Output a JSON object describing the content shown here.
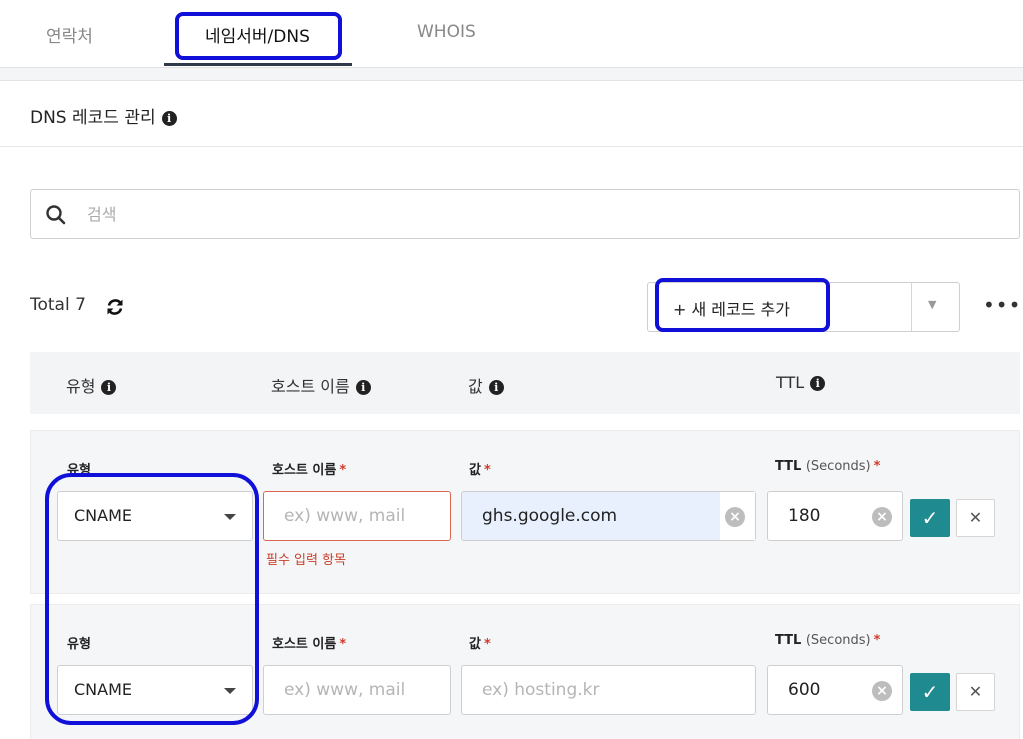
{
  "tabs": [
    {
      "label": "연락처"
    },
    {
      "label": "네임서버/DNS",
      "active": true
    },
    {
      "label": "WHOIS"
    }
  ],
  "panel": {
    "title": "DNS 레코드 관리",
    "search_placeholder": "검색",
    "total_label": "Total 7",
    "add_record_label": "+ 새 레코드 추가"
  },
  "table_header": {
    "type": "유형",
    "host": "호스트 이름",
    "value": "값",
    "ttl": "TTL"
  },
  "form_labels": {
    "type": "유형",
    "host": "호스트 이름",
    "value": "값",
    "ttl": "TTL",
    "ttl_unit": "(Seconds)",
    "required_mark": "*"
  },
  "rows": [
    {
      "type": "CNAME",
      "host_value": "",
      "host_placeholder": "ex) www, mail",
      "host_error": "필수 입력 항목",
      "value": "ghs.google.com",
      "value_placeholder": "",
      "ttl": "180"
    },
    {
      "type": "CNAME",
      "host_value": "",
      "host_placeholder": "ex) www, mail",
      "host_error": "",
      "value": "",
      "value_placeholder": "ex) hosting.kr",
      "ttl": "600"
    }
  ],
  "colors": {
    "highlight": "#1010d8",
    "confirm_button": "#1f8a8f",
    "error": "#c8402a"
  }
}
